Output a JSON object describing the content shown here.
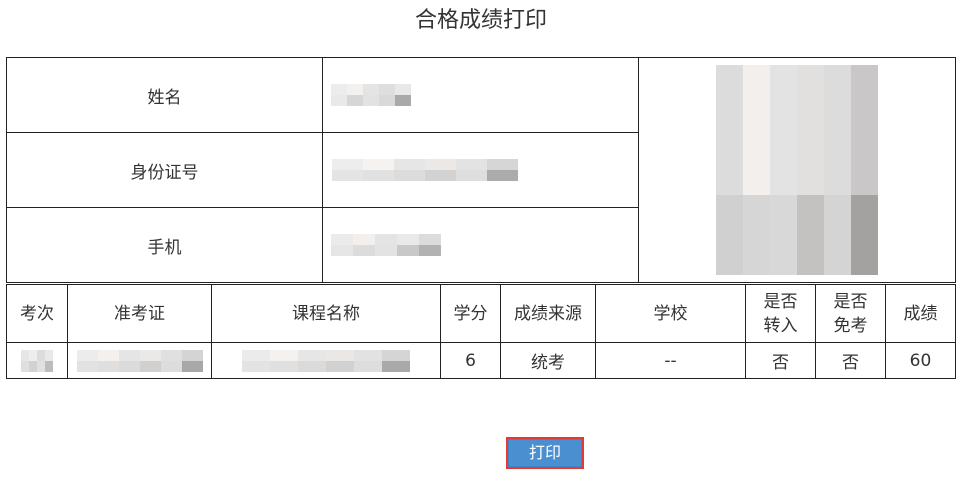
{
  "page": {
    "title": "合格成绩打印"
  },
  "info_labels": {
    "name": "姓名",
    "id_number": "身份证号",
    "phone": "手机"
  },
  "table": {
    "headers": [
      "考次",
      "准考证",
      "课程名称",
      "学分",
      "成绩来源",
      "学校",
      "是否转入",
      "是否免考",
      "成绩"
    ],
    "row": {
      "credit": "6",
      "source": "统考",
      "school": "--",
      "transferred": "否",
      "exempt": "否",
      "score": "60"
    }
  },
  "actions": {
    "print_label": "打印"
  }
}
